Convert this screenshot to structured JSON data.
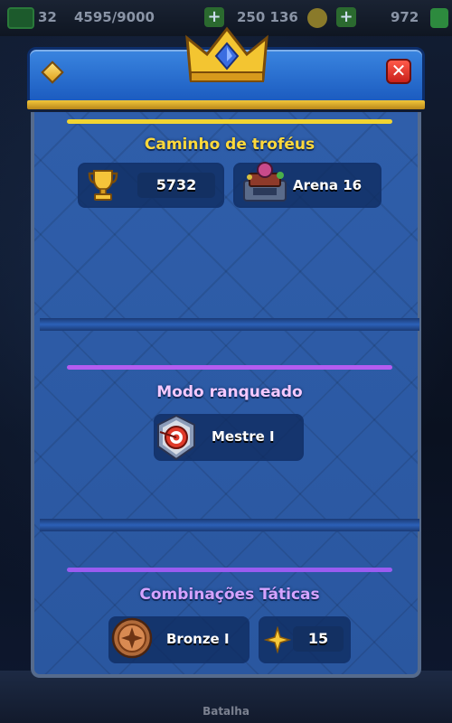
{
  "topbar": {
    "level": "32",
    "xp": "4595/9000",
    "gold": "250 136",
    "gems": "972"
  },
  "bottom_nav": {
    "active_tab": "Batalha"
  },
  "modal": {
    "close_label": "✕",
    "trophy_road": {
      "title": "Caminho de troféus",
      "trophies": "5732",
      "arena": "Arena 16",
      "accent_color": "#f1d431",
      "title_color": "#ffd93b"
    },
    "ranked": {
      "title": "Modo ranqueado",
      "rank": "Mestre I",
      "accent_color": "#b55cf0",
      "title_color": "#f4c9ff"
    },
    "tactics": {
      "title": "Combinações Táticas",
      "league": "Bronze I",
      "stars": "15",
      "accent_color": "#9a5cf0",
      "title_color": "#d5a3ff"
    }
  },
  "icons": {
    "trophy": "trophy-icon",
    "arena": "arena-icon",
    "ranked_badge": "target-badge-icon",
    "bronze_badge": "bronze-star-badge-icon",
    "star": "gold-star-icon",
    "crown": "crown-icon",
    "close": "close-icon"
  }
}
